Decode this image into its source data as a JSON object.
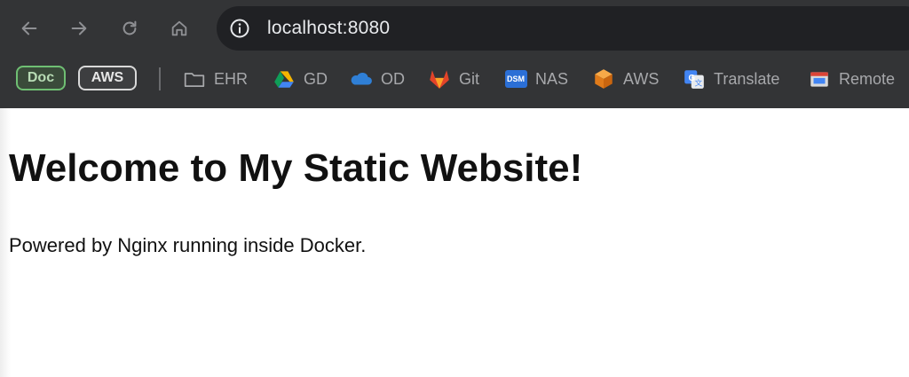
{
  "browser": {
    "url": "localhost:8080",
    "nav": {
      "back_icon": "arrow-left-icon",
      "forward_icon": "arrow-right-icon",
      "reload_icon": "reload-icon",
      "home_icon": "home-icon"
    },
    "site_info_icon": "info-circle-icon",
    "bookmark_pills": [
      {
        "label": "Doc",
        "color": "#6fbf73"
      },
      {
        "label": "AWS",
        "color": "#d9d9d9"
      }
    ],
    "bookmarks": [
      {
        "label": "EHR",
        "icon": "folder-icon"
      },
      {
        "label": "GD",
        "icon": "google-drive-icon"
      },
      {
        "label": "OD",
        "icon": "onedrive-cloud-icon"
      },
      {
        "label": "Git",
        "icon": "gitlab-icon"
      },
      {
        "label": "NAS",
        "icon": "dsm-icon",
        "icon_text": "DSM"
      },
      {
        "label": "AWS",
        "icon": "aws-box-icon"
      },
      {
        "label": "Translate",
        "icon": "google-translate-icon"
      },
      {
        "label": "Remote",
        "icon": "remote-desktop-icon"
      }
    ],
    "colors": {
      "toolbar": "#333436",
      "omnibox": "#202124",
      "bookmark_text": "#a7a8ab"
    }
  },
  "page": {
    "heading": "Welcome to My Static Website!",
    "paragraph": "Powered by Nginx running inside Docker."
  }
}
